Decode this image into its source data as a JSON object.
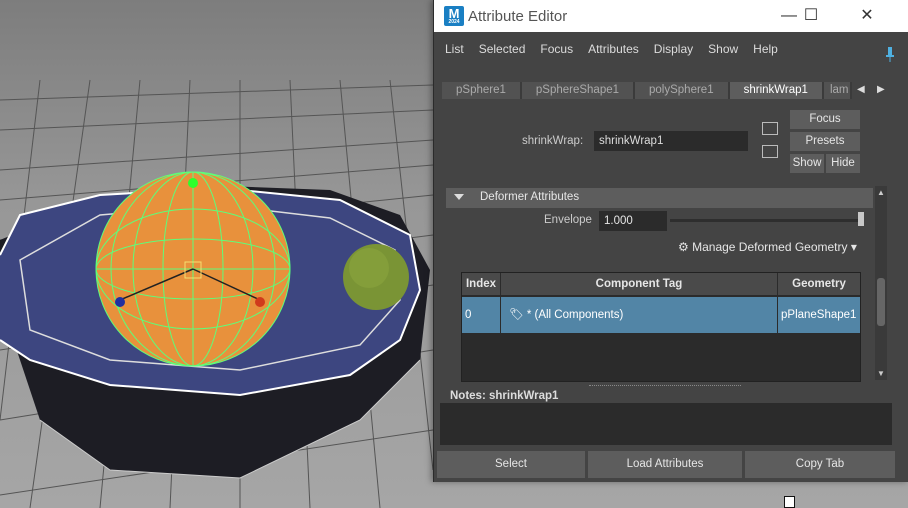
{
  "window": {
    "title": "Attribute Editor",
    "app_icon_letter": "M",
    "app_icon_sub": "2024",
    "controls": {
      "minimize": "—",
      "maximize": "☐",
      "close": "✕"
    }
  },
  "menu": [
    "List",
    "Selected",
    "Focus",
    "Attributes",
    "Display",
    "Show",
    "Help"
  ],
  "tabs": [
    {
      "label": "pSphere1",
      "active": false
    },
    {
      "label": "pSphereShape1",
      "active": false
    },
    {
      "label": "polySphere1",
      "active": false
    },
    {
      "label": "shrinkWrap1",
      "active": true
    },
    {
      "label": "lam",
      "active": false
    }
  ],
  "node": {
    "label": "shrinkWrap:",
    "value": "shrinkWrap1"
  },
  "buttons": {
    "focus": "Focus",
    "presets": "Presets",
    "show": "Show",
    "hide": "Hide"
  },
  "section": {
    "title": "Deformer Attributes"
  },
  "envelope": {
    "label": "Envelope",
    "value": "1.000",
    "slider_fraction": 1.0
  },
  "manage": {
    "label": "Manage Deformed Geometry"
  },
  "table": {
    "headers": [
      "Index",
      "Component Tag",
      "Geometry"
    ],
    "rows": [
      {
        "index": "0",
        "tag": "* (All Components)",
        "geometry": "pPlaneShape1"
      }
    ]
  },
  "notes": {
    "label": "Notes:",
    "node": "shrinkWrap1"
  },
  "bottom_buttons": [
    "Select",
    "Load Attributes",
    "Copy Tab"
  ],
  "colors": {
    "selected_row": "#5285a6",
    "panel": "#444444",
    "sphere_orange": "#e8913c",
    "sphere_green": "#7a9435",
    "wire": "#5dff7a"
  }
}
